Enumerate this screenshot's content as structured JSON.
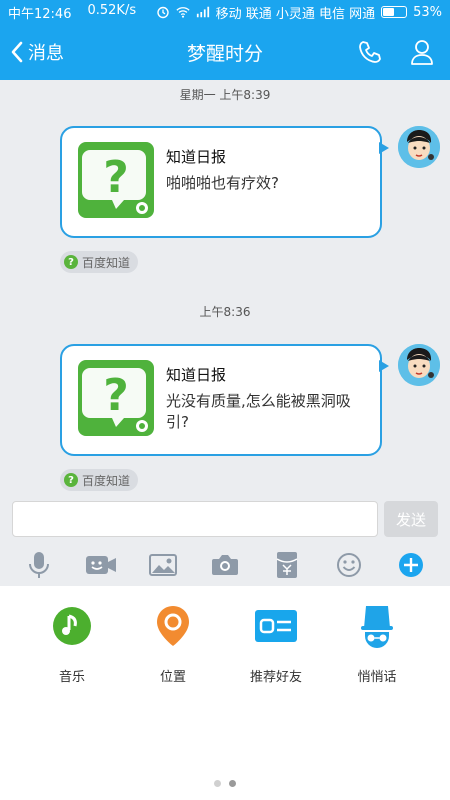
{
  "status_bar": {
    "carrier_left": "中午12:46",
    "speed": "0.52K/s",
    "carriers": "移动 联通 小灵通 电信 网通",
    "battery": "53%",
    "battery_level": 0.53
  },
  "header": {
    "back_label": "消息",
    "title": "梦醒时分"
  },
  "messages": [
    {
      "timestamp": "星期一 上午8:39",
      "title": "知道日报",
      "description": "啪啪啪也有疗效?",
      "source": "百度知道"
    },
    {
      "timestamp": "上午8:36",
      "title": "知道日报",
      "description": "光没有质量,怎么能被黑洞吸引?",
      "source": "百度知道"
    }
  ],
  "input": {
    "value": "",
    "send_label": "发送"
  },
  "toolbar": {
    "icons": [
      "microphone-icon",
      "video-icon",
      "image-icon",
      "camera-icon",
      "red-packet-icon",
      "emoji-icon",
      "plus-icon"
    ]
  },
  "panel": {
    "items": [
      {
        "label": "音乐",
        "icon": "music-icon",
        "color": "#4caf2e"
      },
      {
        "label": "位置",
        "icon": "location-icon",
        "color": "#f28b30"
      },
      {
        "label": "推荐好友",
        "icon": "contact-card-icon",
        "color": "#18a6ec"
      },
      {
        "label": "悄悄话",
        "icon": "whisper-icon",
        "color": "#1fa4e8"
      }
    ],
    "page": 2,
    "page_count": 2
  },
  "colors": {
    "accent": "#1ba5ef",
    "bubble_border": "#2aa0e3"
  }
}
